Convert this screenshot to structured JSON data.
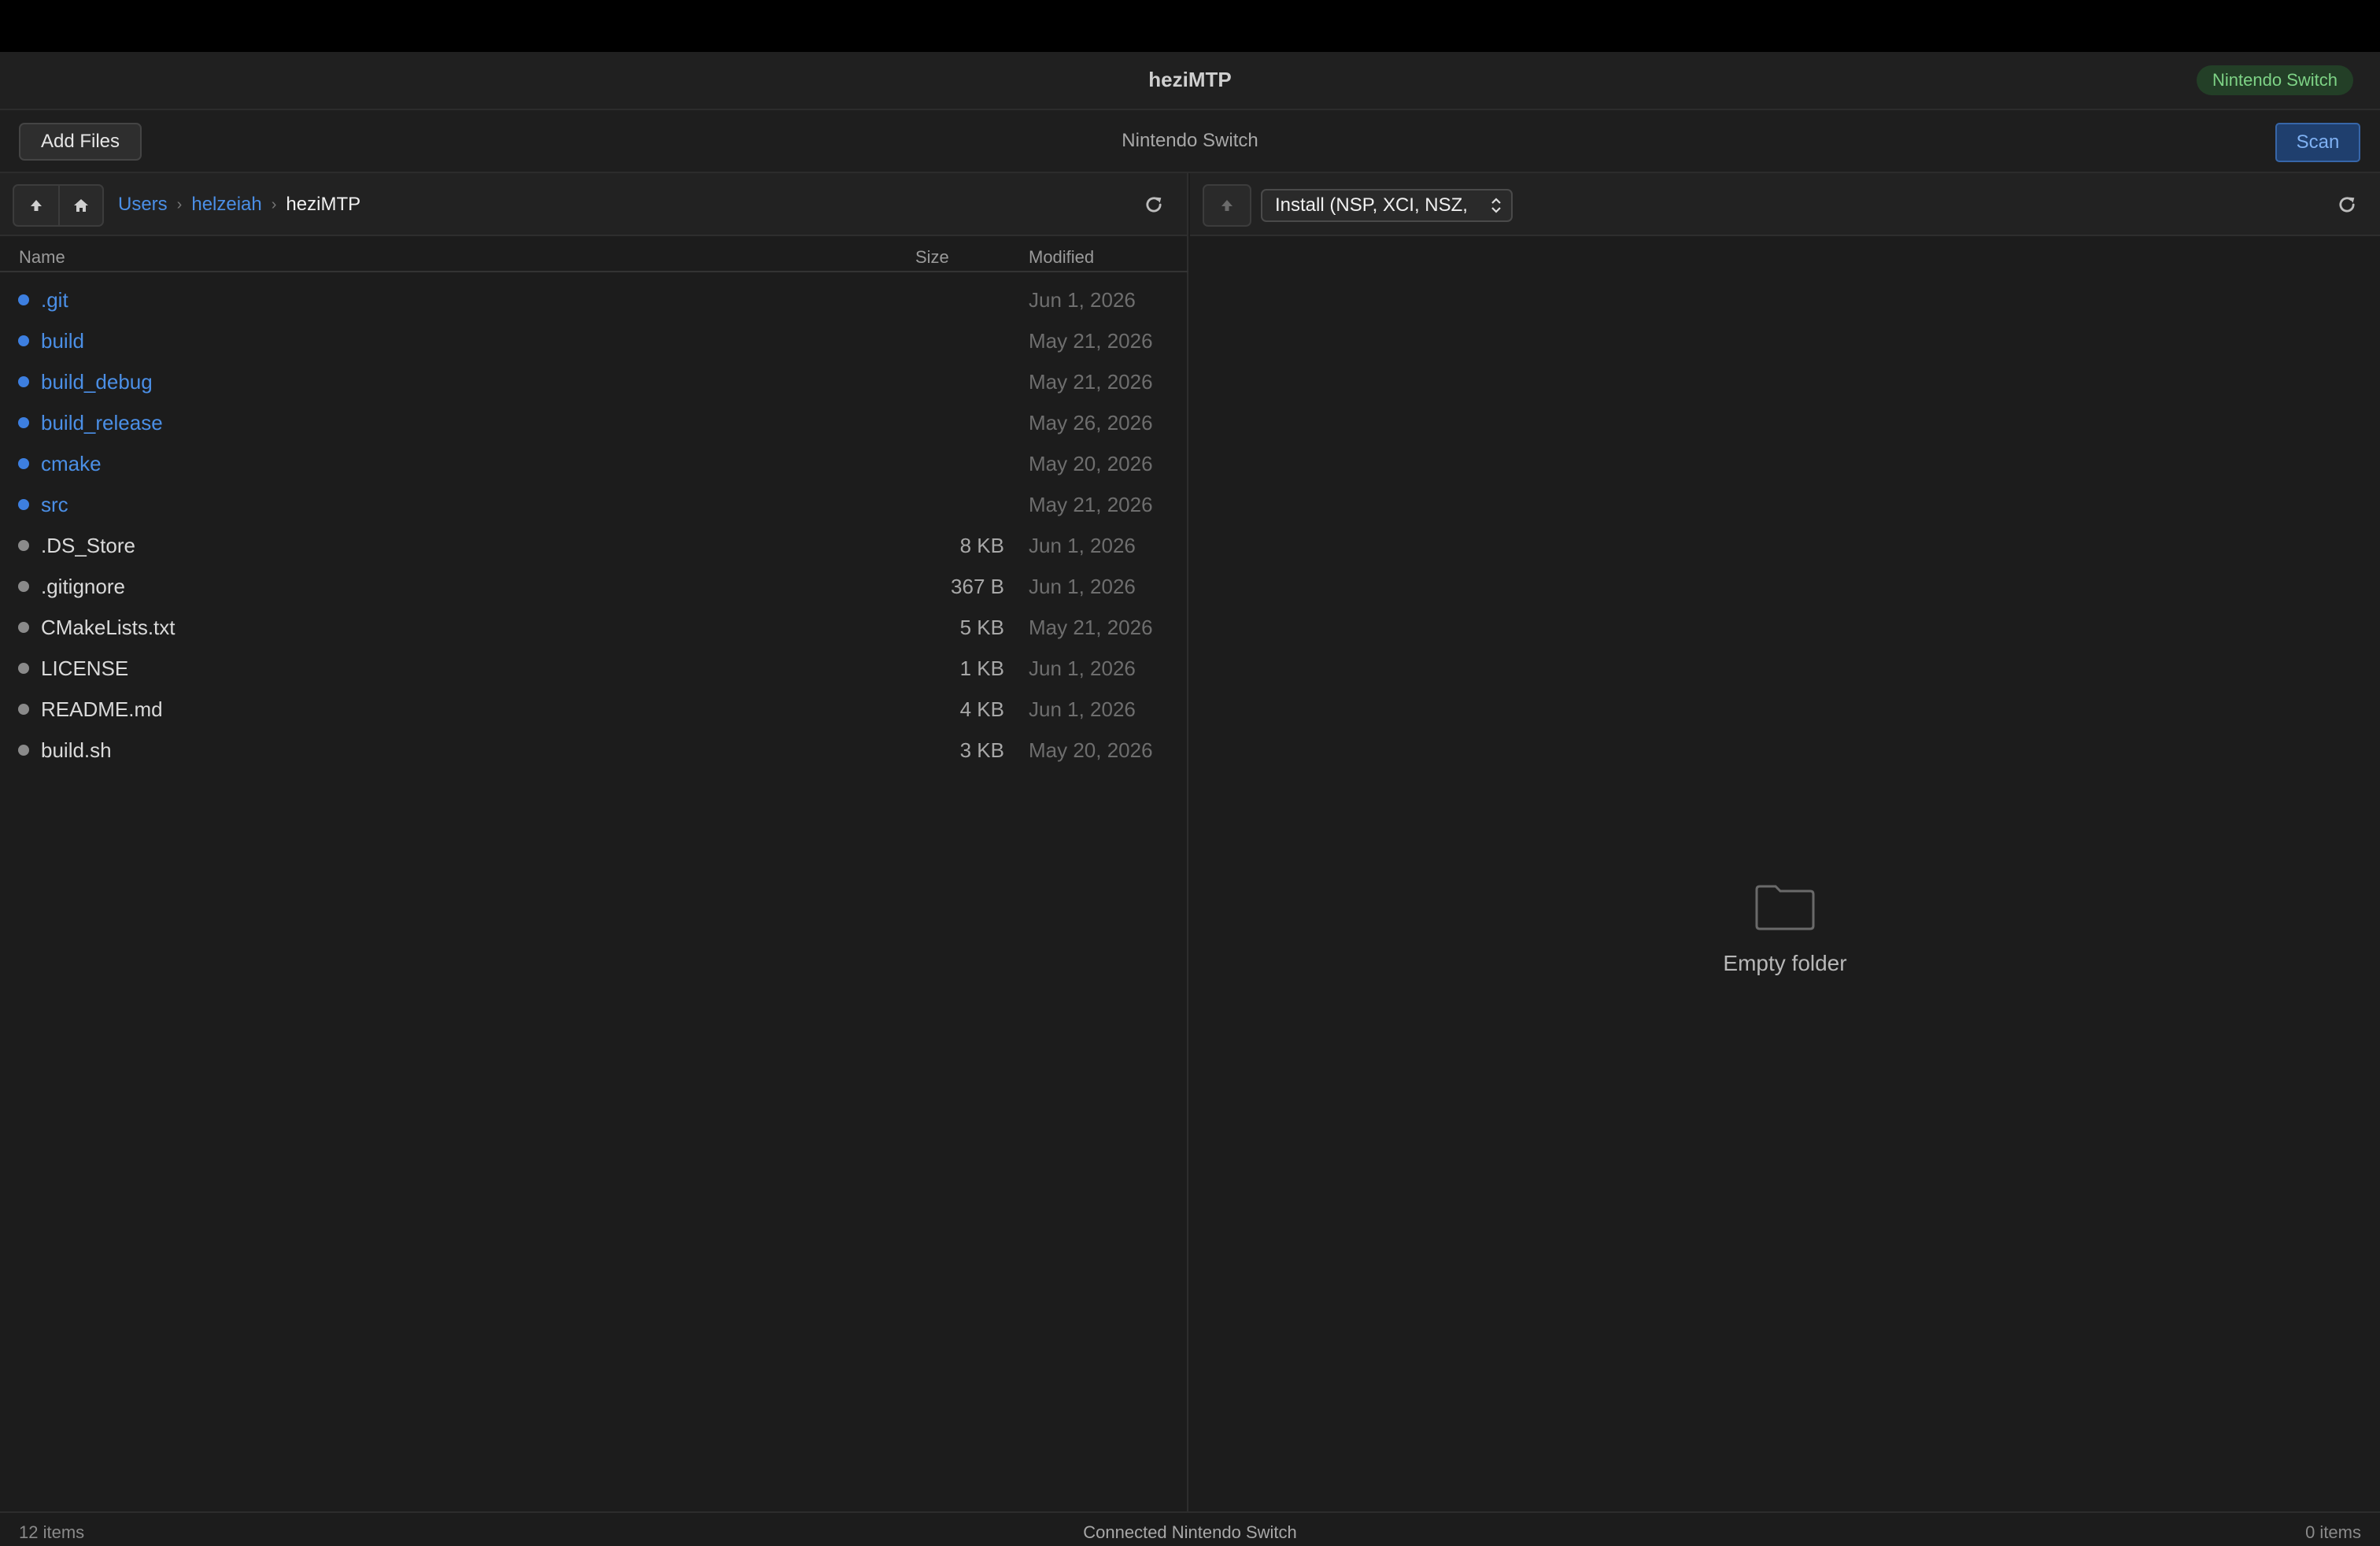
{
  "window": {
    "title": "heziMTP"
  },
  "device_badge": {
    "label": "Nintendo Switch",
    "color": "#7ed386"
  },
  "toolbar": {
    "add_files_label": "Add Files",
    "device_name": "Nintendo Switch",
    "scan_label": "Scan"
  },
  "left_pane": {
    "breadcrumb": [
      "Users",
      "helzeiah",
      "heziMTP"
    ],
    "columns": {
      "name": "Name",
      "size": "Size",
      "modified": "Modified"
    },
    "files": [
      {
        "name": ".git",
        "size": "",
        "modified": "Jun 1, 2026",
        "type": "folder"
      },
      {
        "name": "build",
        "size": "",
        "modified": "May 21, 2026",
        "type": "folder"
      },
      {
        "name": "build_debug",
        "size": "",
        "modified": "May 21, 2026",
        "type": "folder"
      },
      {
        "name": "build_release",
        "size": "",
        "modified": "May 26, 2026",
        "type": "folder"
      },
      {
        "name": "cmake",
        "size": "",
        "modified": "May 20, 2026",
        "type": "folder"
      },
      {
        "name": "src",
        "size": "",
        "modified": "May 21, 2026",
        "type": "folder"
      },
      {
        "name": ".DS_Store",
        "size": "8 KB",
        "modified": "Jun 1, 2026",
        "type": "file"
      },
      {
        "name": ".gitignore",
        "size": "367 B",
        "modified": "Jun 1, 2026",
        "type": "file"
      },
      {
        "name": "CMakeLists.txt",
        "size": "5 KB",
        "modified": "May 21, 2026",
        "type": "file"
      },
      {
        "name": "LICENSE",
        "size": "1 KB",
        "modified": "Jun 1, 2026",
        "type": "file"
      },
      {
        "name": "README.md",
        "size": "4 KB",
        "modified": "Jun 1, 2026",
        "type": "file"
      },
      {
        "name": "build.sh",
        "size": "3 KB",
        "modified": "May 20, 2026",
        "type": "file"
      }
    ]
  },
  "right_pane": {
    "destination": "Install (NSP, XCI, NSZ,",
    "empty_message": "Empty folder"
  },
  "status": {
    "left_count": "12 items",
    "connection": "Connected Nintendo Switch",
    "right_count": "0 items"
  },
  "icons": {
    "up": "arrow-up-icon",
    "home": "home-icon",
    "refresh": "refresh-icon",
    "folder": "folder-icon",
    "select": "chevron-updown-icon"
  },
  "colors": {
    "folder_accent": "#3d7fe0",
    "link": "#4b8fe6",
    "scan_bg": "#1f3f6e",
    "badge_bg": "#233f27"
  }
}
